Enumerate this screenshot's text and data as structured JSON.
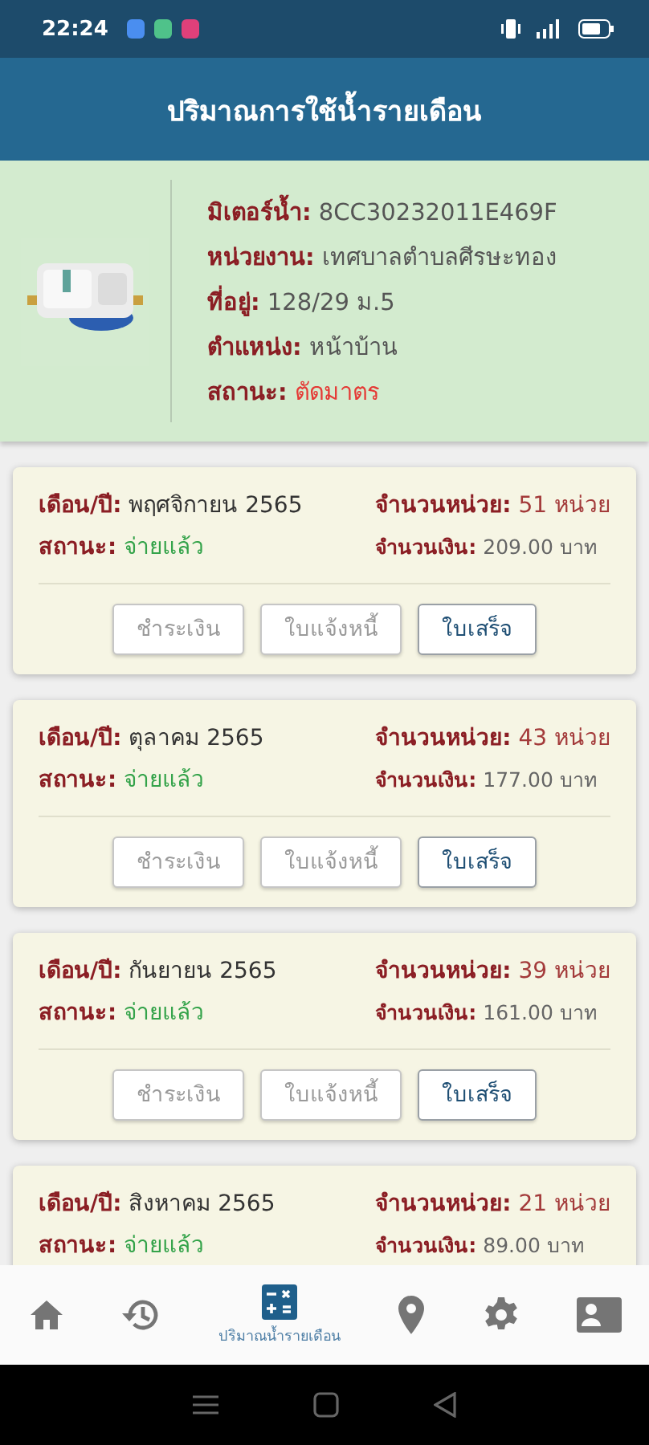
{
  "status_bar": {
    "time": "22:24"
  },
  "header": {
    "title": "ปริมาณการใช้น้ำรายเดือน"
  },
  "meter": {
    "kind": "picture",
    "fields": [
      {
        "label": "มิเตอร์น้ำ:",
        "value": "8CC30232011E469F",
        "color": "#555555"
      },
      {
        "label": "หน่วยงาน:",
        "value": "เทศบาลตำบลศีรษะทอง",
        "color": "#555555"
      },
      {
        "label": "ที่อยู่:",
        "value": "128/29 ม.5",
        "color": "#555555"
      },
      {
        "label": "ตำแหน่ง:",
        "value": "หน้าบ้าน",
        "color": "#555555"
      },
      {
        "label": "สถานะ:",
        "value": "ตัดมาตร",
        "color": "#e53935"
      }
    ]
  },
  "bills": [
    {
      "month": {
        "label": "เดือน/ปี:",
        "value": "พฤศจิกายน 2565"
      },
      "units": {
        "label": "จำนวนหน่วย:",
        "value": "51 หน่วย"
      },
      "status": {
        "label": "สถานะ:",
        "value": "จ่ายแล้ว"
      },
      "amount": {
        "label": "จำนวนเงิน:",
        "value": "209.00 บาท"
      },
      "buttons": [
        {
          "label": "ชำระเงิน",
          "disabled": true
        },
        {
          "label": "ใบแจ้งหนี้",
          "disabled": true
        },
        {
          "label": "ใบเสร็จ",
          "disabled": false
        }
      ]
    },
    {
      "month": {
        "label": "เดือน/ปี:",
        "value": "ตุลาคม 2565"
      },
      "units": {
        "label": "จำนวนหน่วย:",
        "value": "43 หน่วย"
      },
      "status": {
        "label": "สถานะ:",
        "value": "จ่ายแล้ว"
      },
      "amount": {
        "label": "จำนวนเงิน:",
        "value": "177.00 บาท"
      },
      "buttons": [
        {
          "label": "ชำระเงิน",
          "disabled": true
        },
        {
          "label": "ใบแจ้งหนี้",
          "disabled": true
        },
        {
          "label": "ใบเสร็จ",
          "disabled": false
        }
      ]
    },
    {
      "month": {
        "label": "เดือน/ปี:",
        "value": "กันยายน 2565"
      },
      "units": {
        "label": "จำนวนหน่วย:",
        "value": "39 หน่วย"
      },
      "status": {
        "label": "สถานะ:",
        "value": "จ่ายแล้ว"
      },
      "amount": {
        "label": "จำนวนเงิน:",
        "value": "161.00 บาท"
      },
      "buttons": [
        {
          "label": "ชำระเงิน",
          "disabled": true
        },
        {
          "label": "ใบแจ้งหนี้",
          "disabled": true
        },
        {
          "label": "ใบเสร็จ",
          "disabled": false
        }
      ]
    },
    {
      "month": {
        "label": "เดือน/ปี:",
        "value": "สิงหาคม 2565"
      },
      "units": {
        "label": "จำนวนหน่วย:",
        "value": "21 หน่วย"
      },
      "status": {
        "label": "สถานะ:",
        "value": "จ่ายแล้ว"
      },
      "amount": {
        "label": "จำนวนเงิน:",
        "value": "89.00 บาท"
      }
    }
  ],
  "bottom_nav": [
    {
      "kind": "home",
      "selected": false
    },
    {
      "kind": "history",
      "selected": false
    },
    {
      "kind": "calculator",
      "selected": true,
      "label": "ปริมาณน้ำรายเดือน"
    },
    {
      "kind": "location",
      "selected": false
    },
    {
      "kind": "settings",
      "selected": false
    },
    {
      "kind": "contact",
      "selected": false
    }
  ]
}
